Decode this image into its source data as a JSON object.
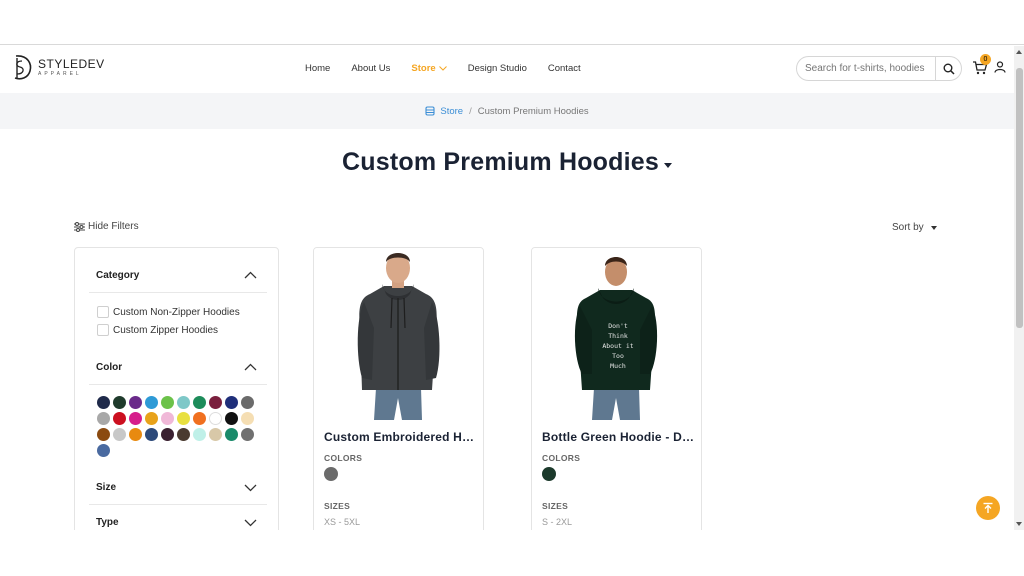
{
  "brand": {
    "name": "STYLEDEV",
    "sub": "APPAREL"
  },
  "nav": {
    "items": [
      {
        "label": "Home"
      },
      {
        "label": "About Us"
      },
      {
        "label": "Store",
        "active": true
      },
      {
        "label": "Design Studio"
      },
      {
        "label": "Contact"
      }
    ]
  },
  "search": {
    "placeholder": "Search for t-shirts, hoodies",
    "icon": "search-icon"
  },
  "cart": {
    "count": "0",
    "icon": "cart-icon"
  },
  "user": {
    "icon": "user-icon"
  },
  "breadcrumb": {
    "store": "Store",
    "separator": "/",
    "current": "Custom Premium Hoodies"
  },
  "page": {
    "title": "Custom Premium Hoodies"
  },
  "toolbar": {
    "hide_filters": "Hide Filters",
    "sort_by": "Sort by"
  },
  "filters": {
    "category": {
      "heading": "Category",
      "options": [
        "Custom Non-Zipper Hoodies",
        "Custom Zipper Hoodies"
      ]
    },
    "color": {
      "heading": "Color",
      "swatches": [
        "#1f2a4a",
        "#1f3b2c",
        "#6a2a8a",
        "#2e9ad6",
        "#6cc24a",
        "#7ec8c8",
        "#1d8c5a",
        "#7a1f3d",
        "#1f2f7a",
        "#6b6b6b",
        "#a8a8a8",
        "#cc1020",
        "#d61e8c",
        "#e8a21a",
        "#f0b8d8",
        "#e8e040",
        "#f07020",
        "#ffffff",
        "#111111",
        "#f5deb3",
        "#8b4a10",
        "#c8c8c8",
        "#e88a10",
        "#2d4a7a",
        "#3a2030",
        "#4a3a30",
        "#bff0e8",
        "#d8c8a8",
        "#1a8a6a",
        "#707070",
        "#4a6aa0"
      ]
    },
    "size": {
      "heading": "Size"
    },
    "type": {
      "heading": "Type"
    }
  },
  "products": [
    {
      "name": "Custom Embroidered Hoodies",
      "colors_label": "COLORS",
      "colors": [
        "#6b6b6b"
      ],
      "sizes_label": "SIZES",
      "sizes": "XS - 5XL"
    },
    {
      "name": "Bottle Green Hoodie - Don't Think About It Too Much",
      "colors_label": "COLORS",
      "colors": [
        "#1c3a2c"
      ],
      "sizes_label": "SIZES",
      "sizes": "S - 2XL",
      "print_text": [
        "Don't",
        "Think",
        "About it",
        "Too",
        "Much"
      ]
    }
  ],
  "colors": {
    "accent": "#f5a623",
    "link": "#3b8ed6",
    "title": "#1a2233"
  }
}
